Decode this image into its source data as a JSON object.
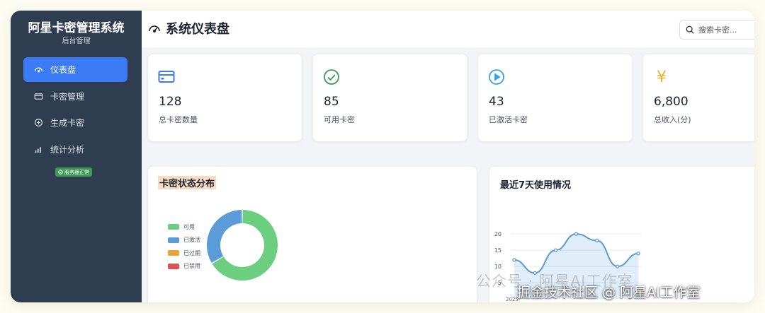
{
  "sidebar": {
    "title": "阿星卡密管理系统",
    "subtitle": "后台管理",
    "items": [
      {
        "label": "仪表盘",
        "icon": "gauge-icon",
        "active": true
      },
      {
        "label": "卡密管理",
        "icon": "card-icon",
        "active": false
      },
      {
        "label": "生成卡密",
        "icon": "plus-circle-icon",
        "active": false
      },
      {
        "label": "统计分析",
        "icon": "bar-chart-icon",
        "active": false
      }
    ],
    "server_status": "服务器正常"
  },
  "header": {
    "title": "系统仪表盘",
    "search_placeholder": "搜索卡密..."
  },
  "stats": [
    {
      "value": "128",
      "label": "总卡密数量",
      "icon": "credit-card-icon",
      "color": "#3b7bf6"
    },
    {
      "value": "85",
      "label": "可用卡密",
      "icon": "check-circle-icon",
      "color": "#3e9a5a"
    },
    {
      "value": "43",
      "label": "已激活卡密",
      "icon": "play-circle-icon",
      "color": "#35a4e6"
    },
    {
      "value": "6,800",
      "label": "总收入(分)",
      "icon": "yen-icon",
      "color": "#e8b22a"
    }
  ],
  "status_panel": {
    "title": "卡密状态分布"
  },
  "usage_panel": {
    "title": "最近7天使用情况"
  },
  "chart_data": [
    {
      "type": "pie",
      "title": "卡密状态分布",
      "categories": [
        "可用",
        "已激活",
        "已过期",
        "已禁用"
      ],
      "values": [
        85,
        43,
        0,
        0
      ],
      "colors": [
        "#6ccf7f",
        "#5b9bd8",
        "#e8a33b",
        "#d9534f"
      ],
      "legend": "left"
    },
    {
      "type": "line",
      "title": "最近7天使用情况",
      "x": [
        "2025-",
        "",
        "",
        "",
        "",
        "",
        ""
      ],
      "series": [
        {
          "values": [
            12,
            8,
            15,
            20,
            18,
            10,
            14
          ]
        }
      ],
      "yticks": [
        5,
        10,
        15,
        20
      ],
      "ylim": [
        0,
        22
      ],
      "grid": true,
      "color": "#5b9bd8"
    }
  ],
  "watermarks": {
    "wechat": "公众号 · 阿星AI工作室",
    "juejin": "掘金技术社区 @ 阿星AI工作室"
  }
}
